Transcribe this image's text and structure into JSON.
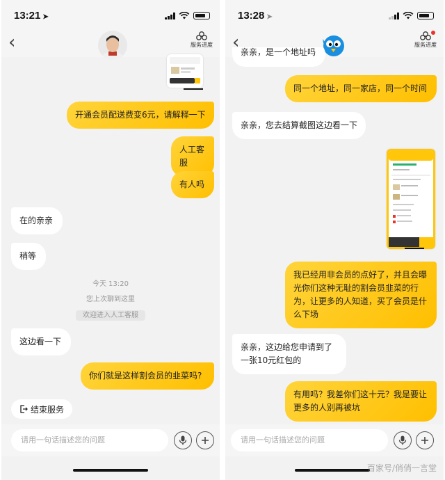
{
  "left": {
    "status": {
      "time": "13:21",
      "loc_icon": "location-arrow"
    },
    "nav": {
      "progress_label": "服务进度"
    },
    "messages": [
      "开通会员配送费变6元，请解释一下",
      "人工客服",
      "有人吗",
      "在的亲亲",
      "稍等",
      "这边看一下",
      "你们就是这样割会员的韭菜吗?"
    ],
    "system": {
      "time": "今天 13:20",
      "last_read": "您上次聊到这里",
      "entered": "欢迎进入人工客服"
    },
    "end_service": "结束服务",
    "input_placeholder": "请用一句话描述您的问题"
  },
  "right": {
    "status": {
      "time": "13:28"
    },
    "nav": {
      "progress_label": "服务进度"
    },
    "messages": [
      "亲亲，是一个地址吗",
      "同一个地址，同一家店，同一个时间",
      "亲亲，您去结算截图这边看一下",
      "我已经用非会员的点好了，并且会曝光你们这种无耻的割会员韭菜的行为，让更多的人知道，买了会员是什么下场",
      "亲亲，这边给您申请到了一张10元红包的",
      "有用吗？我差你们这十元？我是要让更多的人别再被坑"
    ],
    "input_placeholder": "请用一句话描述您的问题"
  },
  "watermark": "百家号/俏俏一言堂",
  "colors": {
    "user_bubble": "#ffc60a",
    "agent_bubble": "#ffffff",
    "background": "#f2f2f2"
  }
}
